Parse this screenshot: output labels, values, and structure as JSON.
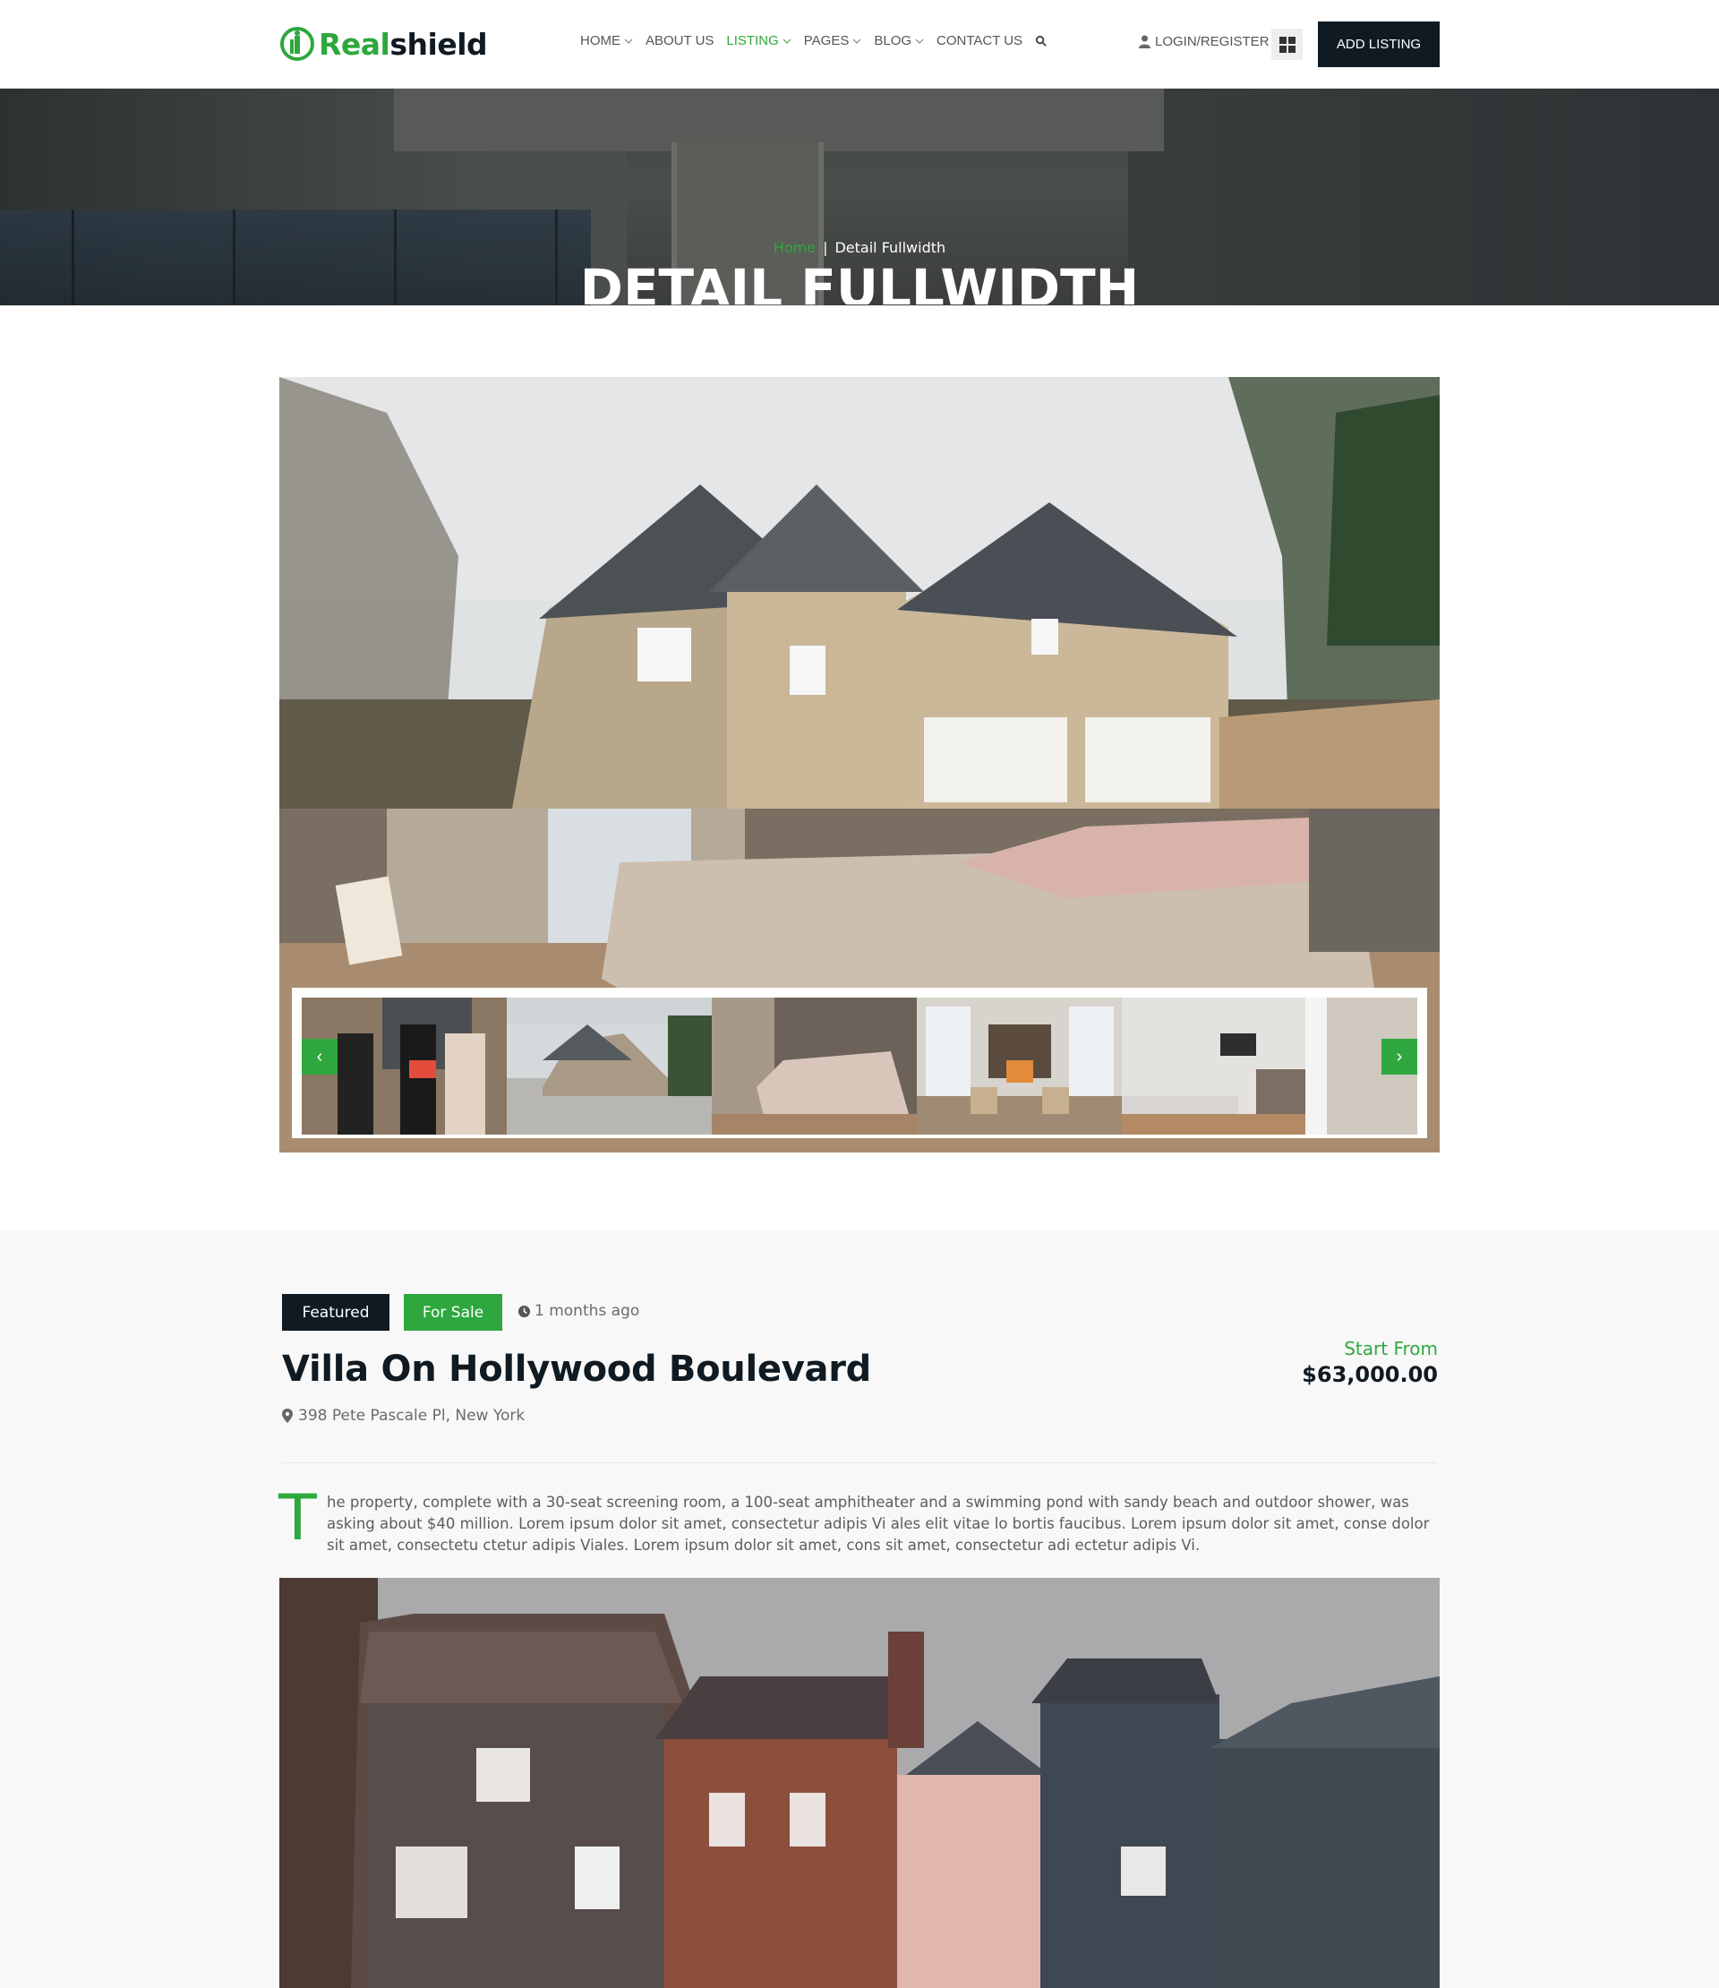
{
  "header": {
    "logo": {
      "part1": "Real",
      "part2": "shield"
    },
    "nav": [
      {
        "label": "HOME",
        "dropdown": true,
        "active": false
      },
      {
        "label": "ABOUT US",
        "dropdown": false,
        "active": false
      },
      {
        "label": "LISTING",
        "dropdown": true,
        "active": true
      },
      {
        "label": "PAGES",
        "dropdown": true,
        "active": false
      },
      {
        "label": "BLOG",
        "dropdown": true,
        "active": false
      },
      {
        "label": "CONTACT US",
        "dropdown": false,
        "active": false
      }
    ],
    "login_label": "LOGIN/REGISTER",
    "add_listing_label": "ADD LISTING"
  },
  "banner": {
    "breadcrumb_home": "Home",
    "breadcrumb_sep": "|",
    "breadcrumb_current": "Detail Fullwidth",
    "title": "DETAIL FULLWIDTH"
  },
  "gallery": {
    "prev_icon": "‹",
    "next_icon": "›"
  },
  "listing": {
    "badge_featured": "Featured",
    "badge_status": "For Sale",
    "posted": "1 months ago",
    "title": "Villa On Hollywood Boulevard",
    "address": "398 Pete Pascale Pl, New York",
    "price_label": "Start From",
    "price": "$63,000.00",
    "description_dropcap": "T",
    "description": "he property, complete with a 30-seat screening room, a 100-seat amphitheater and a swimming pond with sandy beach and outdoor shower, was asking about $40 million. Lorem ipsum dolor sit amet, consectetur adipis Vi ales elit vitae lo bortis faucibus. Lorem ipsum dolor sit amet, conse dolor sit amet, consectetu ctetur adipis Viales. Lorem ipsum dolor sit amet, cons sit amet, consectetur adi ectetur adipis Vi."
  },
  "colors": {
    "brand_green": "#2ea83e",
    "dark": "#0f1a22"
  }
}
